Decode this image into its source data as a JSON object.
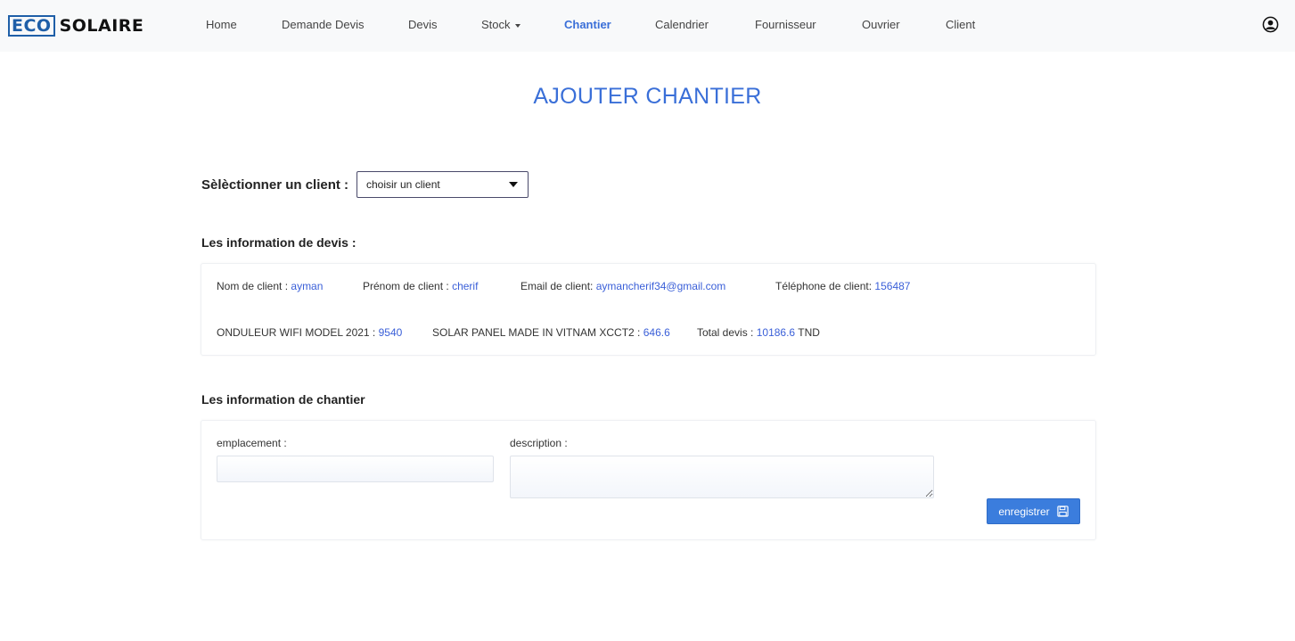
{
  "brand": {
    "eco": "ECO",
    "solaire": "SOLAIRE"
  },
  "nav": {
    "items": [
      {
        "label": "Home"
      },
      {
        "label": "Demande Devis"
      },
      {
        "label": "Devis"
      },
      {
        "label": "Stock"
      },
      {
        "label": "Chantier",
        "active": true
      },
      {
        "label": "Calendrier"
      },
      {
        "label": "Fournisseur"
      },
      {
        "label": "Ouvrier"
      },
      {
        "label": "Client"
      }
    ],
    "user_icon": "user-circle-icon"
  },
  "page_title": "AJOUTER CHANTIER",
  "client_select": {
    "label": "Sèlèctionner un client :",
    "selected": "choisir un client"
  },
  "devis_section": {
    "title": "Les information de devis :",
    "nom_label": "Nom de client :",
    "nom_value": "ayman",
    "prenom_label": "Prénom de client :",
    "prenom_value": "cherif",
    "email_label": "Email de client:",
    "email_value": "aymancherif34@gmail.com",
    "tel_label": "Téléphone de client:",
    "tel_value": "156487",
    "item1_label": "ONDULEUR WIFI MODEL 2021 :",
    "item1_value": "9540",
    "item2_label": "SOLAR PANEL MADE IN VITNAM XCCT2 :",
    "item2_value": "646.6",
    "total_label": "Total devis :",
    "total_value": "10186.6",
    "total_unit": "TND"
  },
  "chantier_section": {
    "title": "Les information de chantier",
    "emplacement_label": "emplacement :",
    "emplacement_value": "",
    "description_label": "description :",
    "description_value": "",
    "save_label": "enregistrer",
    "save_icon": "save-floppy-icon"
  },
  "colors": {
    "accent": "#3a6fd8",
    "button": "#3b7ddd",
    "value": "#3a5fd8",
    "navbar_bg": "#f8f9fa"
  }
}
